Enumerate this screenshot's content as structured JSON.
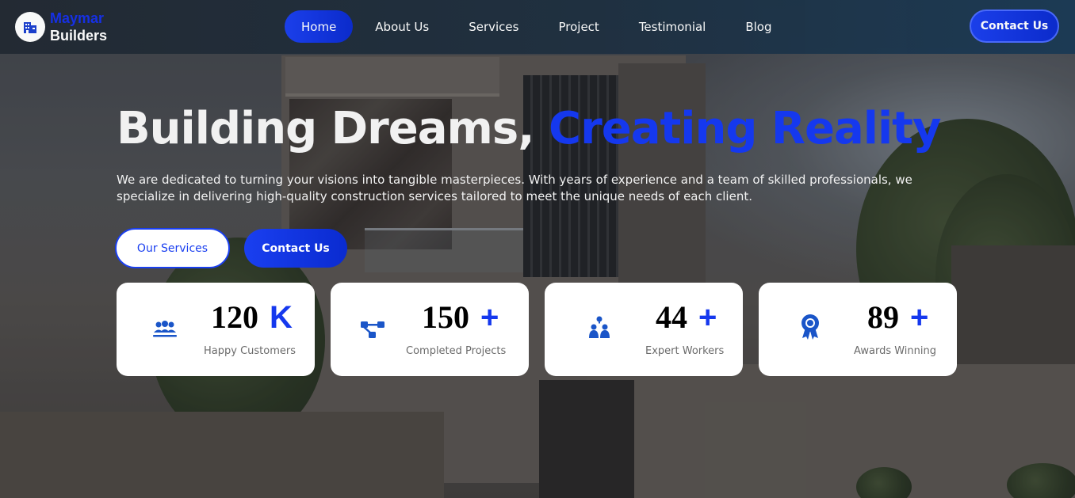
{
  "brand": {
    "line1": "Maymar",
    "line2": "Builders"
  },
  "nav": {
    "items": [
      "Home",
      "About Us",
      "Services",
      "Project",
      "Testimonial",
      "Blog"
    ],
    "active": "Home",
    "contact_button": "Contact Us"
  },
  "hero": {
    "title_part1": "Building Dreams,",
    "title_highlight": "Creating Reality",
    "description": "We are dedicated to turning your visions into tangible masterpieces. With years of experience and a team of skilled professionals, we specialize in delivering high-quality construction services tailored to meet the unique needs of each client.",
    "primary_button": "Our Services",
    "secondary_button": "Contact Us"
  },
  "stats": [
    {
      "icon": "users-group-icon",
      "number": "120",
      "suffix": "K",
      "label": "Happy Customers"
    },
    {
      "icon": "project-diagram-icon",
      "number": "150",
      "suffix": "+",
      "label": "Completed Projects"
    },
    {
      "icon": "workers-icon",
      "number": "44",
      "suffix": "+",
      "label": "Expert Workers"
    },
    {
      "icon": "award-ribbon-icon",
      "number": "89",
      "suffix": "+",
      "label": "Awards Winning"
    }
  ],
  "colors": {
    "accent": "#1538ee",
    "navbar": "#1f3040",
    "card": "#ffffff"
  }
}
